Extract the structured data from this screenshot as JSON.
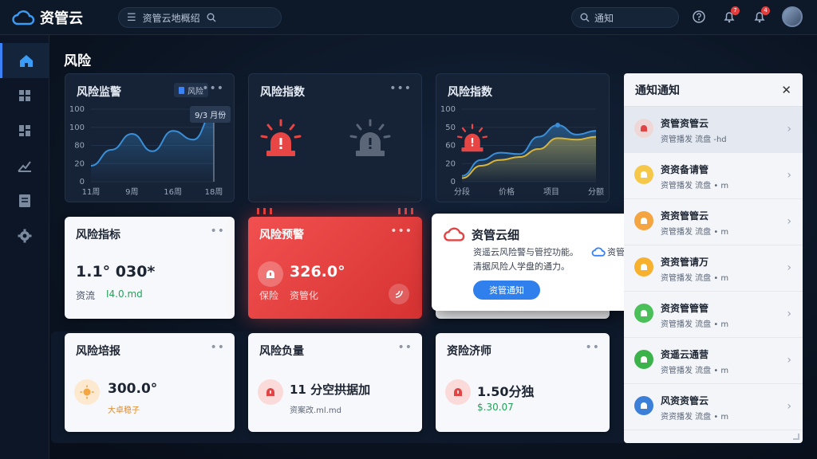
{
  "app": {
    "name": "资管云"
  },
  "topbar": {
    "search_text": "资管云地概绍",
    "notice_search": "通知",
    "badges": [
      "7",
      "4"
    ]
  },
  "page": {
    "title": "风险"
  },
  "cards": {
    "risk_monitor": {
      "title": "风险监警",
      "tag": "风险",
      "tooltip": "9/3 月份"
    },
    "risk_index_alarm": {
      "title": "风险指数"
    },
    "risk_index_chart": {
      "title": "风险指数"
    },
    "risk_indicator": {
      "title": "风险指标",
      "value": "1.1° 030*",
      "label": "资流",
      "sub_value": "I4.0.md"
    },
    "risk_warning": {
      "title": "风险预警",
      "value": "326.0°",
      "label": "保险",
      "sub_label": "资管化"
    },
    "risk_report": {
      "title": "风险培报",
      "value": "300.0°",
      "sub": "大卓稳子"
    },
    "risk_load": {
      "title": "风险负量",
      "value": "11 分空拱据加",
      "sub": "资案改.ml.md"
    },
    "risk_evaluation": {
      "title": "资险济师",
      "value": "1.50分独",
      "sub": "$.30.07"
    }
  },
  "chart_data": [
    {
      "type": "area",
      "title": "风险监警",
      "x": [
        "11周",
        "9周",
        "16周",
        "18周"
      ],
      "y_ticks": [
        "0",
        "20",
        "80",
        "100",
        "100"
      ],
      "series": [
        {
          "values": [
            22,
            44,
            66,
            42,
            70,
            58,
            96
          ]
        }
      ]
    },
    {
      "type": "area",
      "title": "风险指数",
      "x": [
        "分段",
        "价格",
        "项目",
        "分额"
      ],
      "y_ticks": [
        "0",
        "20",
        "60",
        "50",
        "100"
      ],
      "series": [
        {
          "color": "#3a8fd8",
          "values": [
            8,
            30,
            40,
            38,
            62,
            78,
            65,
            70
          ]
        },
        {
          "color": "#d9b43a",
          "values": [
            5,
            22,
            30,
            34,
            45,
            60,
            58,
            62
          ]
        }
      ]
    }
  ],
  "popup": {
    "title": "资管云细",
    "line1": "资遥云风险警与管控功能。",
    "brand": "资管云,",
    "line2": "清据风险人学盘的通力。",
    "button": "资管通知"
  },
  "drawer": {
    "title": "通知通知",
    "items": [
      {
        "title": "资管资管云",
        "sub": "资管播发  流盘  -hd",
        "color": "#f0d7d7",
        "fg": "#e04545"
      },
      {
        "title": "资资备请管",
        "sub": "资管播发  流盘  • m",
        "color": "#f5c84a",
        "fg": "#ffffff"
      },
      {
        "title": "资资管管云",
        "sub": "资管播发  流盘  • m",
        "color": "#f5a442",
        "fg": "#ffffff"
      },
      {
        "title": "资资管请万",
        "sub": "资管播发  流盘  • m",
        "color": "#f7b12e",
        "fg": "#ffffff"
      },
      {
        "title": "资资管管管",
        "sub": "资管播发  流盘  • m",
        "color": "#4bc05a",
        "fg": "#ffffff"
      },
      {
        "title": "资遥云通营",
        "sub": "资管播发  流盘  • m",
        "color": "#3bb34a",
        "fg": "#ffffff"
      },
      {
        "title": "风资资管云",
        "sub": "资资播发  流盘  • m",
        "color": "#3b7fd9",
        "fg": "#ffffff"
      }
    ]
  },
  "colors": {
    "accent": "#3b82f6",
    "danger": "#e53b3b",
    "success": "#22a35a",
    "warning": "#f5a442"
  }
}
